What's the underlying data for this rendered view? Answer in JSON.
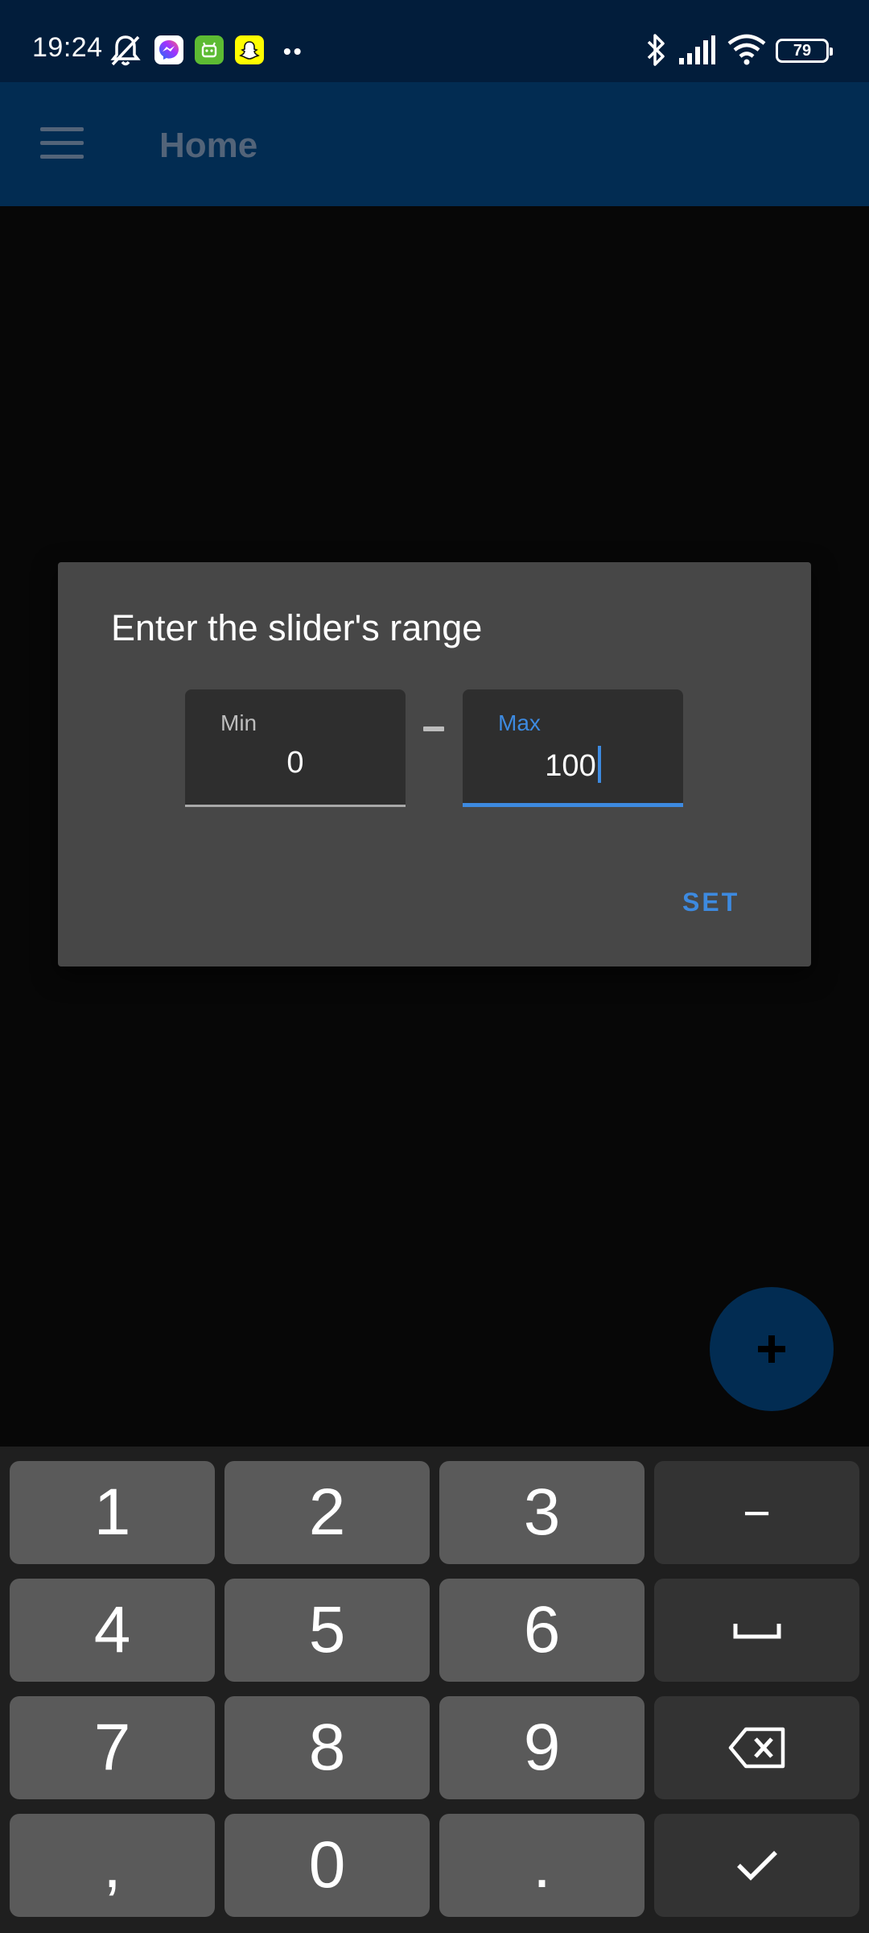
{
  "status_bar": {
    "time": "19:24",
    "battery": "79",
    "icons": [
      "mute-bell-icon",
      "messenger-app-icon",
      "android-app-icon",
      "snapchat-app-icon",
      "more-dots-icon",
      "bluetooth-icon",
      "signal-icon",
      "wifi-icon",
      "battery-icon"
    ],
    "more_dots": "••"
  },
  "app_bar": {
    "title": "Home",
    "menu_icon": "hamburger-menu-icon"
  },
  "dialog": {
    "title": "Enter the slider's range",
    "min_field": {
      "label": "Min",
      "value": "0"
    },
    "separator": "-",
    "max_field": {
      "label": "Max",
      "value": "100"
    },
    "set_label": "SET"
  },
  "fab": {
    "icon": "plus-icon"
  },
  "keyboard": {
    "rows": [
      [
        "1",
        "2",
        "3",
        "−"
      ],
      [
        "4",
        "5",
        "6",
        "space"
      ],
      [
        "7",
        "8",
        "9",
        "backspace"
      ],
      [
        ",",
        "0",
        ".",
        "done"
      ]
    ],
    "keys": {
      "k1": "1",
      "k2": "2",
      "k3": "3",
      "minus": "−",
      "k4": "4",
      "k5": "5",
      "k6": "6",
      "k7": "7",
      "k8": "8",
      "k9": "9",
      "comma": ",",
      "k0": "0",
      "dot": "."
    }
  },
  "colors": {
    "status_bar_bg": "#021d3b",
    "app_bar_bg": "#022c52",
    "dialog_bg": "#474747",
    "accent": "#3d8ae0",
    "key_bg": "#5a5a5a",
    "key_dark_bg": "#333333"
  }
}
